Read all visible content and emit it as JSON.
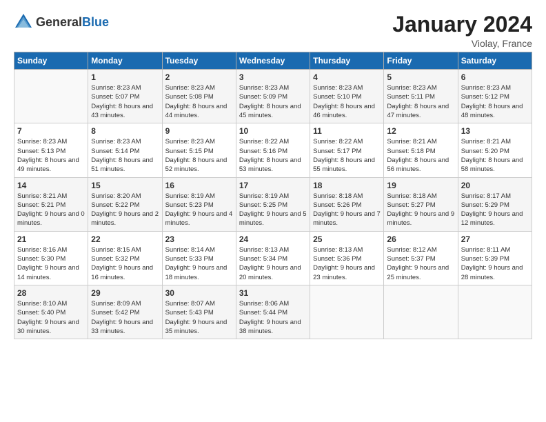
{
  "header": {
    "logo_general": "General",
    "logo_blue": "Blue",
    "month_title": "January 2024",
    "location": "Violay, France"
  },
  "weekdays": [
    "Sunday",
    "Monday",
    "Tuesday",
    "Wednesday",
    "Thursday",
    "Friday",
    "Saturday"
  ],
  "weeks": [
    [
      {
        "day": "",
        "sunrise": "",
        "sunset": "",
        "daylight": ""
      },
      {
        "day": "1",
        "sunrise": "Sunrise: 8:23 AM",
        "sunset": "Sunset: 5:07 PM",
        "daylight": "Daylight: 8 hours and 43 minutes."
      },
      {
        "day": "2",
        "sunrise": "Sunrise: 8:23 AM",
        "sunset": "Sunset: 5:08 PM",
        "daylight": "Daylight: 8 hours and 44 minutes."
      },
      {
        "day": "3",
        "sunrise": "Sunrise: 8:23 AM",
        "sunset": "Sunset: 5:09 PM",
        "daylight": "Daylight: 8 hours and 45 minutes."
      },
      {
        "day": "4",
        "sunrise": "Sunrise: 8:23 AM",
        "sunset": "Sunset: 5:10 PM",
        "daylight": "Daylight: 8 hours and 46 minutes."
      },
      {
        "day": "5",
        "sunrise": "Sunrise: 8:23 AM",
        "sunset": "Sunset: 5:11 PM",
        "daylight": "Daylight: 8 hours and 47 minutes."
      },
      {
        "day": "6",
        "sunrise": "Sunrise: 8:23 AM",
        "sunset": "Sunset: 5:12 PM",
        "daylight": "Daylight: 8 hours and 48 minutes."
      }
    ],
    [
      {
        "day": "7",
        "sunrise": "Sunrise: 8:23 AM",
        "sunset": "Sunset: 5:13 PM",
        "daylight": "Daylight: 8 hours and 49 minutes."
      },
      {
        "day": "8",
        "sunrise": "Sunrise: 8:23 AM",
        "sunset": "Sunset: 5:14 PM",
        "daylight": "Daylight: 8 hours and 51 minutes."
      },
      {
        "day": "9",
        "sunrise": "Sunrise: 8:23 AM",
        "sunset": "Sunset: 5:15 PM",
        "daylight": "Daylight: 8 hours and 52 minutes."
      },
      {
        "day": "10",
        "sunrise": "Sunrise: 8:22 AM",
        "sunset": "Sunset: 5:16 PM",
        "daylight": "Daylight: 8 hours and 53 minutes."
      },
      {
        "day": "11",
        "sunrise": "Sunrise: 8:22 AM",
        "sunset": "Sunset: 5:17 PM",
        "daylight": "Daylight: 8 hours and 55 minutes."
      },
      {
        "day": "12",
        "sunrise": "Sunrise: 8:21 AM",
        "sunset": "Sunset: 5:18 PM",
        "daylight": "Daylight: 8 hours and 56 minutes."
      },
      {
        "day": "13",
        "sunrise": "Sunrise: 8:21 AM",
        "sunset": "Sunset: 5:20 PM",
        "daylight": "Daylight: 8 hours and 58 minutes."
      }
    ],
    [
      {
        "day": "14",
        "sunrise": "Sunrise: 8:21 AM",
        "sunset": "Sunset: 5:21 PM",
        "daylight": "Daylight: 9 hours and 0 minutes."
      },
      {
        "day": "15",
        "sunrise": "Sunrise: 8:20 AM",
        "sunset": "Sunset: 5:22 PM",
        "daylight": "Daylight: 9 hours and 2 minutes."
      },
      {
        "day": "16",
        "sunrise": "Sunrise: 8:19 AM",
        "sunset": "Sunset: 5:23 PM",
        "daylight": "Daylight: 9 hours and 4 minutes."
      },
      {
        "day": "17",
        "sunrise": "Sunrise: 8:19 AM",
        "sunset": "Sunset: 5:25 PM",
        "daylight": "Daylight: 9 hours and 5 minutes."
      },
      {
        "day": "18",
        "sunrise": "Sunrise: 8:18 AM",
        "sunset": "Sunset: 5:26 PM",
        "daylight": "Daylight: 9 hours and 7 minutes."
      },
      {
        "day": "19",
        "sunrise": "Sunrise: 8:18 AM",
        "sunset": "Sunset: 5:27 PM",
        "daylight": "Daylight: 9 hours and 9 minutes."
      },
      {
        "day": "20",
        "sunrise": "Sunrise: 8:17 AM",
        "sunset": "Sunset: 5:29 PM",
        "daylight": "Daylight: 9 hours and 12 minutes."
      }
    ],
    [
      {
        "day": "21",
        "sunrise": "Sunrise: 8:16 AM",
        "sunset": "Sunset: 5:30 PM",
        "daylight": "Daylight: 9 hours and 14 minutes."
      },
      {
        "day": "22",
        "sunrise": "Sunrise: 8:15 AM",
        "sunset": "Sunset: 5:32 PM",
        "daylight": "Daylight: 9 hours and 16 minutes."
      },
      {
        "day": "23",
        "sunrise": "Sunrise: 8:14 AM",
        "sunset": "Sunset: 5:33 PM",
        "daylight": "Daylight: 9 hours and 18 minutes."
      },
      {
        "day": "24",
        "sunrise": "Sunrise: 8:13 AM",
        "sunset": "Sunset: 5:34 PM",
        "daylight": "Daylight: 9 hours and 20 minutes."
      },
      {
        "day": "25",
        "sunrise": "Sunrise: 8:13 AM",
        "sunset": "Sunset: 5:36 PM",
        "daylight": "Daylight: 9 hours and 23 minutes."
      },
      {
        "day": "26",
        "sunrise": "Sunrise: 8:12 AM",
        "sunset": "Sunset: 5:37 PM",
        "daylight": "Daylight: 9 hours and 25 minutes."
      },
      {
        "day": "27",
        "sunrise": "Sunrise: 8:11 AM",
        "sunset": "Sunset: 5:39 PM",
        "daylight": "Daylight: 9 hours and 28 minutes."
      }
    ],
    [
      {
        "day": "28",
        "sunrise": "Sunrise: 8:10 AM",
        "sunset": "Sunset: 5:40 PM",
        "daylight": "Daylight: 9 hours and 30 minutes."
      },
      {
        "day": "29",
        "sunrise": "Sunrise: 8:09 AM",
        "sunset": "Sunset: 5:42 PM",
        "daylight": "Daylight: 9 hours and 33 minutes."
      },
      {
        "day": "30",
        "sunrise": "Sunrise: 8:07 AM",
        "sunset": "Sunset: 5:43 PM",
        "daylight": "Daylight: 9 hours and 35 minutes."
      },
      {
        "day": "31",
        "sunrise": "Sunrise: 8:06 AM",
        "sunset": "Sunset: 5:44 PM",
        "daylight": "Daylight: 9 hours and 38 minutes."
      },
      {
        "day": "",
        "sunrise": "",
        "sunset": "",
        "daylight": ""
      },
      {
        "day": "",
        "sunrise": "",
        "sunset": "",
        "daylight": ""
      },
      {
        "day": "",
        "sunrise": "",
        "sunset": "",
        "daylight": ""
      }
    ]
  ]
}
